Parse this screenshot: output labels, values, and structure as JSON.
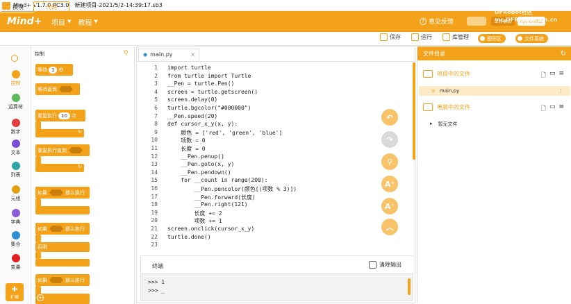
{
  "titlebar": {
    "app": "Mind+ V1.7.0 RC3.0",
    "project": "新建项目-2021/5/2-14:39:17.sb3"
  },
  "menubar": {
    "brand": "Mind+",
    "menus": [
      "项目",
      "教程"
    ],
    "feedback": "意见反馈",
    "upload_mode": "上传模式",
    "python_mode": "Python模式",
    "watermark": "DFRobot社区 mc.DFRobot.com.cn"
  },
  "mode_tabs": {
    "blocks": "模块",
    "code": "代码"
  },
  "toolbar": {
    "save": "保存",
    "run": "运行",
    "library": "库管理",
    "graphics": "图形区",
    "filesystem": "文件系统"
  },
  "categories": [
    {
      "label": "控制",
      "color": "#f5a21b"
    },
    {
      "label": "运算符",
      "color": "#5cb85c"
    },
    {
      "label": "数字",
      "color": "#e63c3c"
    },
    {
      "label": "文本",
      "color": "#7b4fd6"
    },
    {
      "label": "列表",
      "color": "#2ea4a4"
    },
    {
      "label": "元组",
      "color": "#e0a010"
    },
    {
      "label": "字典",
      "color": "#8a5ad8"
    },
    {
      "label": "集合",
      "color": "#2d8fd6"
    },
    {
      "label": "变量",
      "color": "#e02020"
    }
  ],
  "ext_label": "扩展",
  "palette": {
    "title": "控制",
    "blocks": [
      {
        "text": "等待",
        "value": "1",
        "suffix": "秒"
      },
      {
        "text": "等待直到"
      },
      {
        "text": "重复执行",
        "value": "10",
        "suffix": "次"
      },
      {
        "text": "重复执行直到"
      },
      {
        "text": "如果",
        "suffix": "那么执行"
      },
      {
        "text": "如果",
        "suffix": "那么执行",
        "else": "否则"
      },
      {
        "text": "如果",
        "suffix": "那么执行"
      }
    ]
  },
  "editor": {
    "file_tab": "main.py",
    "lines": [
      "import turtle",
      "from turtle import Turtle",
      "__Pen = turtle.Pen()",
      "screen = turtle.getscreen()",
      "screen.delay(0)",
      "turtle.bgcolor(\"#000000\")",
      "__Pen.speed(20)",
      "def cursor_x_y(x, y):",
      "    颜色 = ['red', 'green', 'blue']",
      "    项数 = 0",
      "    长度 = 0",
      "    __Pen.penup()",
      "    __Pen.goto(x, y)",
      "    __Pen.pendown()",
      "    for __count in range(200):",
      "        __Pen.pencolor(颜色[(项数 % 3)])",
      "        __Pen.forward(长度)",
      "        __Pen.right(121)",
      "        长度 += 2",
      "        项数 += 1",
      "screen.onclick(cursor_x_y)",
      "turtle.done()",
      ""
    ],
    "line_numbers": [
      "1",
      "2",
      "3",
      "4",
      "5",
      "6",
      "7",
      "8",
      "9",
      "10",
      "11",
      "12",
      "13",
      "14",
      "15",
      "16",
      "17",
      "18",
      "19",
      "20",
      "21",
      "22",
      "23"
    ]
  },
  "terminal": {
    "title": "终端",
    "clear": "清除输出",
    "output": [
      ">>> 1",
      ">>> _"
    ]
  },
  "files": {
    "title": "文件目录",
    "project_section": "项目中的文件",
    "project_file": "main.py",
    "computer_section": "电脑中的文件",
    "computer_item": "暂无文件"
  }
}
